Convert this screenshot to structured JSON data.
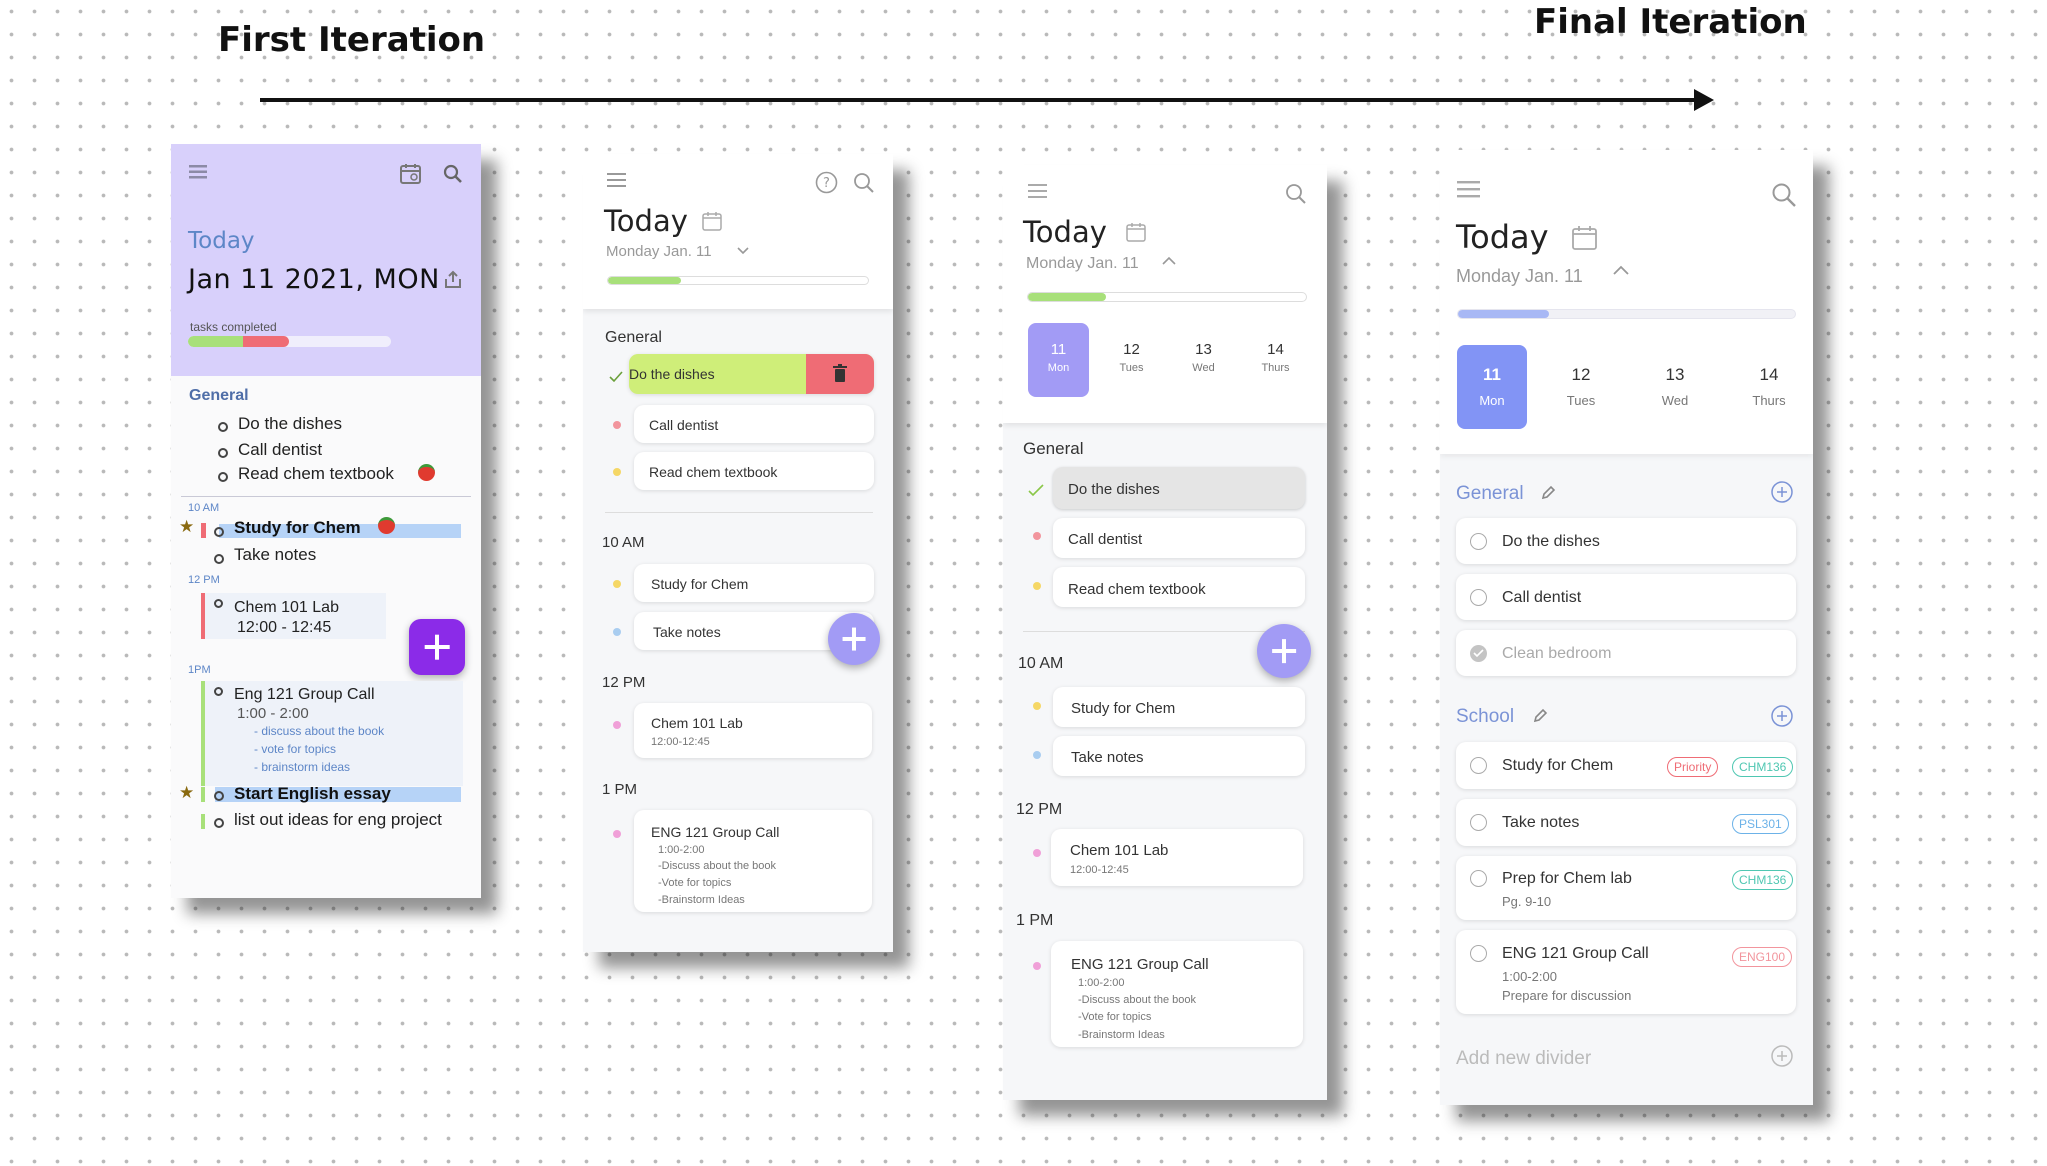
{
  "labels": {
    "first": "First Iteration",
    "final": "Final Iteration"
  },
  "icons": {
    "menu": "hamburger-menu-icon",
    "calendar": "calendar-icon",
    "search": "search-icon",
    "help": "help-icon",
    "share": "share-icon",
    "trash": "trash-icon",
    "check": "check-icon",
    "chevron_down": "chevron-down-icon",
    "chevron_up": "chevron-up-icon",
    "pencil": "pencil-icon",
    "add_circle": "add-circle-icon",
    "plus": "plus-icon",
    "star": "star-icon",
    "tomato": "tomato-icon"
  },
  "colors": {
    "lavender": "#d8d0fb",
    "accent_purple": "#a29bf5",
    "fab_dark": "#8b2be8",
    "green": "#a8e07a",
    "red": "#ef6c75",
    "blue_progress": "#a8b8f5",
    "section_blue": "#5d86c7"
  },
  "screen1": {
    "today": "Today",
    "date": "Jan 11 2021, MON",
    "tasks_completed": "tasks completed",
    "progress": 0.5,
    "general": "General",
    "general_items": [
      "Do the dishes",
      "Call dentist",
      "Read chem textbook"
    ],
    "time_10": "10 AM",
    "study_chem": "Study for Chem",
    "take_notes": "Take notes",
    "time_12": "12 PM",
    "chem_lab": "Chem 101 Lab",
    "chem_lab_time": "12:00 - 12:45",
    "time_1": "1PM",
    "eng_call": "Eng 121 Group Call",
    "eng_time": "1:00 - 2:00",
    "eng_notes": [
      "- discuss about the book",
      "- vote for topics",
      "- brainstorm ideas"
    ],
    "essay": "Start English essay",
    "ideas": "list out ideas for eng project"
  },
  "screen2": {
    "today": "Today",
    "date": "Monday Jan. 11",
    "progress": 0.28,
    "general": "General",
    "general_items": [
      "Do the dishes",
      "Call dentist",
      "Read chem textbook"
    ],
    "time_10": "10 AM",
    "items_10": [
      "Study for Chem",
      "Take notes"
    ],
    "time_12": "12 PM",
    "chem_lab": "Chem 101 Lab",
    "chem_lab_time": "12:00-12:45",
    "time_1": "1 PM",
    "eng_call": "ENG 121 Group Call",
    "eng_lines": [
      "1:00-2:00",
      "-Discuss about the book",
      "-Vote for topics",
      "-Brainstorm Ideas"
    ]
  },
  "screen3": {
    "today": "Today",
    "date": "Monday Jan. 11",
    "progress": 0.28,
    "days": [
      {
        "num": "11",
        "name": "Mon"
      },
      {
        "num": "12",
        "name": "Tues"
      },
      {
        "num": "13",
        "name": "Wed"
      },
      {
        "num": "14",
        "name": "Thurs"
      }
    ],
    "general": "General",
    "general_items": [
      "Do the dishes",
      "Call dentist",
      "Read chem textbook"
    ],
    "time_10": "10 AM",
    "items_10": [
      "Study for Chem",
      "Take notes"
    ],
    "time_12": "12 PM",
    "chem_lab": "Chem 101 Lab",
    "chem_lab_time": "12:00-12:45",
    "time_1": "1 PM",
    "eng_call": "ENG 121 Group Call",
    "eng_lines": [
      "1:00-2:00",
      "-Discuss about the book",
      "-Vote for topics",
      "-Brainstorm Ideas"
    ]
  },
  "screen4": {
    "today": "Today",
    "date": "Monday Jan. 11",
    "progress": 0.27,
    "days": [
      {
        "num": "11",
        "name": "Mon"
      },
      {
        "num": "12",
        "name": "Tues"
      },
      {
        "num": "13",
        "name": "Wed"
      },
      {
        "num": "14",
        "name": "Thurs"
      }
    ],
    "general": "General",
    "general_items": [
      "Do the dishes",
      "Call dentist",
      "Clean bedroom"
    ],
    "school": "School",
    "study_chem": "Study for Chem",
    "tag_priority": "Priority",
    "tag_chm136": "CHM136",
    "take_notes": "Take notes",
    "tag_psl301": "PSL301",
    "prep_lab": "Prep for Chem lab",
    "prep_pages": "Pg. 9-10",
    "eng_call": "ENG 121 Group Call",
    "eng_time": "1:00-2:00",
    "eng_prepare": "Prepare for discussion",
    "tag_eng100": "ENG100",
    "add_divider": "Add new divider"
  }
}
